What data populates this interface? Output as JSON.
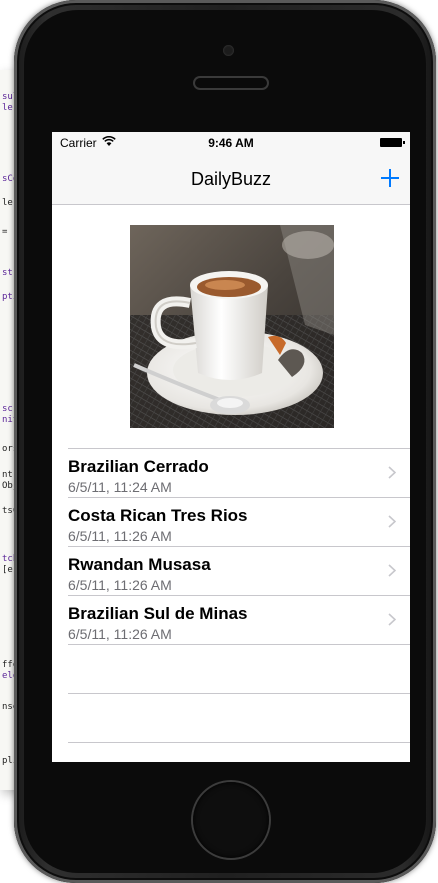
{
  "status_bar": {
    "carrier": "Carrier",
    "time": "9:46 AM"
  },
  "nav": {
    "title": "DailyBuzz",
    "add_icon": "plus-icon"
  },
  "coffees": [
    {
      "name": "Brazilian Cerrado",
      "date": "6/5/11, 11:24 AM"
    },
    {
      "name": "Costa Rican Tres Rios",
      "date": "6/5/11, 11:26 AM"
    },
    {
      "name": "Rwandan Musasa",
      "date": "6/5/11, 11:26 AM"
    },
    {
      "name": "Brazilian Sul de Minas",
      "date": "6/5/11, 11:26 AM"
    }
  ],
  "code_fragments": [
    "sul",
    "ler",
    "sCo",
    "ler",
    "=",
    "st",
    "pti",
    "scr",
    "nit",
    "ors",
    "ntr",
    "Obj",
    "tsC",
    "tch",
    "[er",
    "ffe",
    "ele",
    "nse",
    "pli"
  ],
  "colors": {
    "accent": "#007aff",
    "separator": "#c8c7cc",
    "subtitle": "#6d6d72"
  }
}
